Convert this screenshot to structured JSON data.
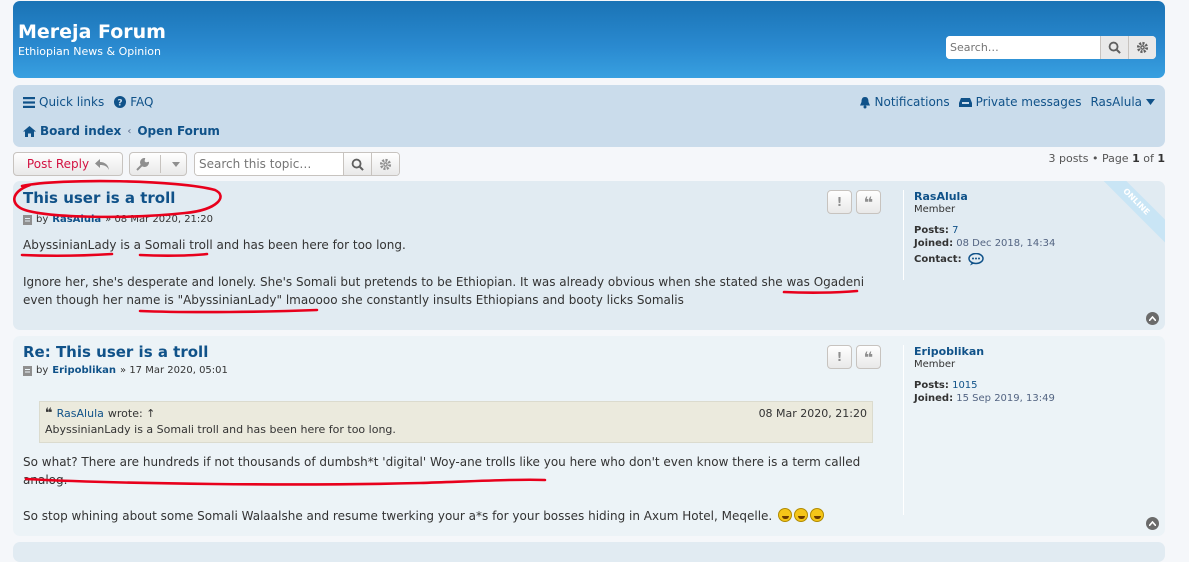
{
  "header": {
    "site_title": "Mereja Forum",
    "site_description": "Ethiopian News & Opinion",
    "search_placeholder": "Search…"
  },
  "nav": {
    "quick_links": "Quick links",
    "faq": "FAQ",
    "notifications": "Notifications",
    "private_messages": "Private messages",
    "username": "RasAlula",
    "breadcrumbs": [
      "Board index",
      "Open Forum"
    ]
  },
  "action_bar": {
    "post_reply": "Post Reply",
    "search_topic_placeholder": "Search this topic…",
    "pagination": {
      "count_text": "3 posts • Page",
      "current": "1",
      "of": "of",
      "total": "1"
    }
  },
  "posts": [
    {
      "title": "This user is a troll",
      "by": "by",
      "author": "RasAlula",
      "date": "» 08 Mar 2020, 21:20",
      "paragraphs": [
        "AbyssinianLady is a Somali troll and has been here for too long.",
        "Ignore her, she's desperate and lonely. She's Somali but pretends to be Ethiopian.  It was already obvious when she stated she was Ogadeni even though her name is \"AbyssinianLady\" lmaoooo she constantly insults Ethiopians and booty licks Somalis"
      ],
      "profile": {
        "name": "RasAlula",
        "rank": "Member",
        "posts_label": "Posts:",
        "posts": "7",
        "joined_label": "Joined:",
        "joined": "08 Dec 2018, 14:34",
        "contact_label": "Contact:",
        "online_label": "ONLINE"
      }
    },
    {
      "title": "Re: This user is a troll",
      "by": "by",
      "author": "Eripoblikan",
      "date": "» 17 Mar 2020, 05:01",
      "quote": {
        "author": "RasAlula",
        "wrote": "wrote: ↑",
        "date": "08 Mar 2020, 21:20",
        "text": "AbyssinianLady is a Somali troll and has been here for too long."
      },
      "paragraphs": [
        "So what? There are hundreds if not thousands of dumbsh*t 'digital' Woy-ane trolls like you here who don't even know there is a term called analog.",
        "So stop whining about some Somali Walaalshe and resume twerking your a*s for your bosses hiding in Axum Hotel, Meqelle."
      ],
      "profile": {
        "name": "Eripoblikan",
        "rank": "Member",
        "posts_label": "Posts:",
        "posts": "1015",
        "joined_label": "Joined:",
        "joined": "15 Sep 2019, 13:49"
      }
    }
  ],
  "colors": {
    "header_gradient_top": "#1a73b5",
    "navbar_bg": "#cadceb",
    "post_bg_1": "#e1ebf2",
    "post_bg_2": "#ecf3f7",
    "link": "#105289",
    "post_reply_red": "#d31141",
    "annotation_red": "#e8001c"
  }
}
